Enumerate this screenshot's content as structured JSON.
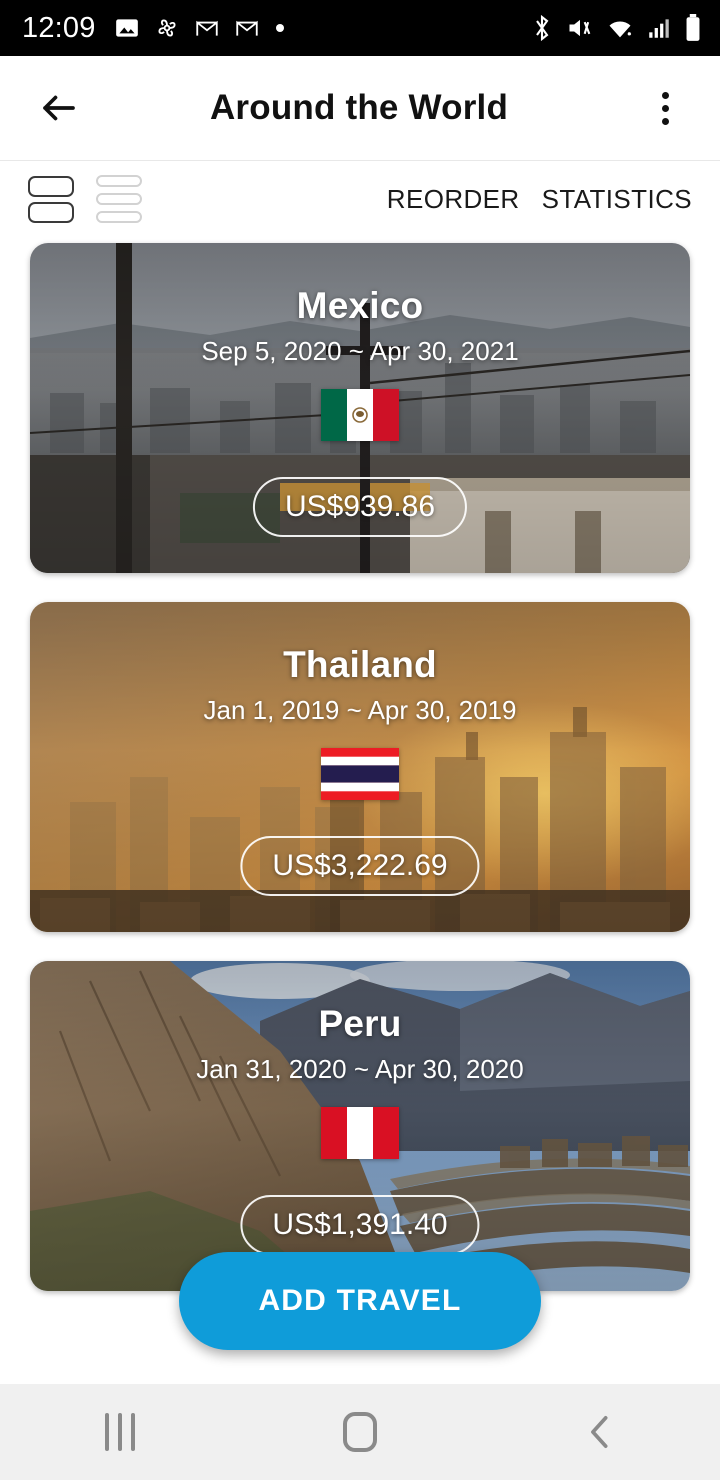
{
  "status_bar": {
    "time": "12:09",
    "left_icons": [
      "photo-icon",
      "pinwheel-icon",
      "gmail-icon",
      "gmail-icon",
      "dot-icon"
    ],
    "right_icons": [
      "bluetooth-icon",
      "mute-icon",
      "wifi-icon",
      "signal-icon",
      "battery-icon"
    ]
  },
  "app_bar": {
    "back_icon": "back-arrow-icon",
    "title": "Around the World",
    "overflow_icon": "overflow-menu-icon"
  },
  "toolbar": {
    "view_card_icon": "card-view-icon",
    "view_list_icon": "list-view-icon",
    "reorder_label": "REORDER",
    "statistics_label": "STATISTICS"
  },
  "travels": [
    {
      "country": "Mexico",
      "dates": "Sep 5, 2020 ~ Apr 30, 2021",
      "price": "US$939.86",
      "flag": "mexico-flag-icon"
    },
    {
      "country": "Thailand",
      "dates": "Jan 1, 2019 ~ Apr 30, 2019",
      "price": "US$3,222.69",
      "flag": "thailand-flag-icon"
    },
    {
      "country": "Peru",
      "dates": "Jan 31, 2020 ~ Apr 30, 2020",
      "price": "US$1,391.40",
      "flag": "peru-flag-icon"
    }
  ],
  "fab": {
    "label": "ADD TRAVEL",
    "color": "#0f9cd9"
  },
  "nav_bar": {
    "recents_icon": "recents-icon",
    "home_icon": "home-icon",
    "back_icon": "nav-back-icon"
  }
}
